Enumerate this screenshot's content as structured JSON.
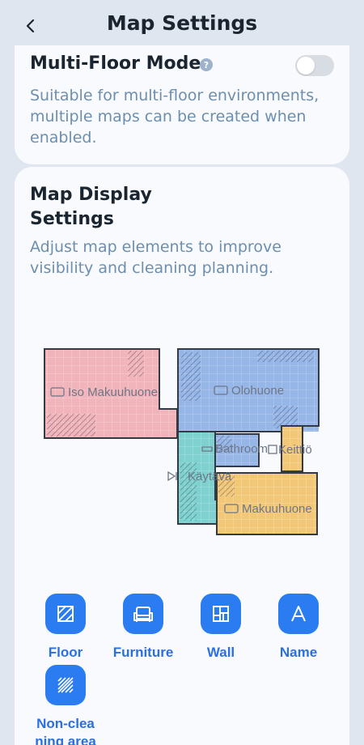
{
  "header": {
    "title": "Map Settings"
  },
  "multi_floor": {
    "title": "Multi-Floor Mode",
    "help": "?",
    "enabled": false,
    "description": "Suitable for multi-floor environments, multiple maps can be created when enabled."
  },
  "map_display": {
    "title": "Map Display Settings",
    "description": "Adjust map elements to improve visibility and cleaning planning."
  },
  "map": {
    "rooms": [
      {
        "name": "Iso Makuuhuone",
        "color": "#f2b4bb"
      },
      {
        "name": "Olohuone",
        "color": "#97b6e8"
      },
      {
        "name": "Bathroom",
        "color": "#97b6e8"
      },
      {
        "name": "Keittiö",
        "color": "#f2c878"
      },
      {
        "name": "Käytävä",
        "color": "#7ed1cf"
      },
      {
        "name": "Makuuhuone",
        "color": "#f2c878"
      }
    ]
  },
  "tools": [
    {
      "label": "Floor",
      "icon": "floor-icon"
    },
    {
      "label": "Furniture",
      "icon": "furniture-icon"
    },
    {
      "label": "Wall",
      "icon": "wall-icon"
    },
    {
      "label": "Name",
      "icon": "name-icon"
    },
    {
      "label": "Non-clea ning area",
      "icon": "non-cleaning-area-icon"
    }
  ],
  "colors": {
    "accent": "#2b7cf0",
    "background": "#dfe6ef",
    "card": "#f8fafd"
  }
}
